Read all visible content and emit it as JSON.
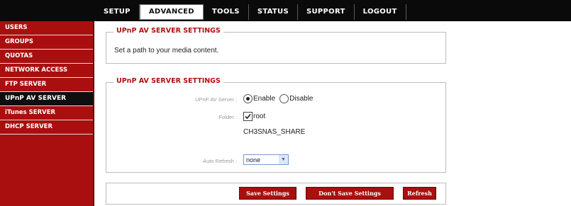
{
  "nav": {
    "tabs": [
      "SETUP",
      "ADVANCED",
      "TOOLS",
      "STATUS",
      "SUPPORT",
      "LOGOUT"
    ],
    "active_tab": "ADVANCED"
  },
  "sidebar": {
    "items": [
      "USERS",
      "GROUPS",
      "QUOTAS",
      "NETWORK ACCESS",
      "FTP SERVER",
      "UPnP AV SERVER",
      "iTunes SERVER",
      "DHCP SERVER"
    ],
    "active_item": "UPnP AV SERVER"
  },
  "intro_panel": {
    "title": "UPnP AV SERVER SETTINGS",
    "description": "Set a path to your media content."
  },
  "settings_panel": {
    "title": "UPnP AV SERVER SETTINGS",
    "server_label": "UPnP AV Server :",
    "enable_label": "Enable",
    "disable_label": "Disable",
    "server_enabled": true,
    "folder_label": "Folder :",
    "folder_name": "root",
    "folder_checked": true,
    "share_name": "CH3SNAS_SHARE",
    "auto_refresh_label": "Auto Refresh :",
    "auto_refresh_value": "none"
  },
  "actions": {
    "save": "Save Settings",
    "dont_save": "Don't Save Settings",
    "refresh": "Refresh"
  },
  "colors": {
    "accent": "#aa0f0f",
    "navbar": "#0a0a0a",
    "title": "#b01010"
  }
}
